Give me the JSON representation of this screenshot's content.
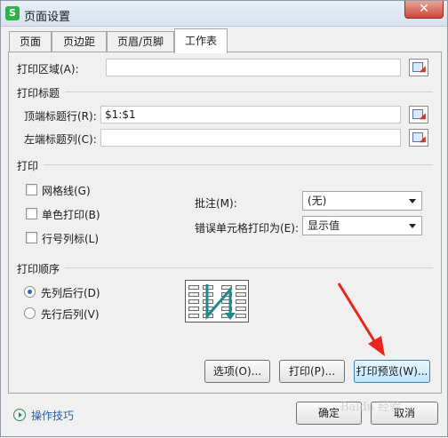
{
  "window": {
    "title": "页面设置",
    "app_icon_letter": "S",
    "close_glyph": "✕"
  },
  "tabs": [
    {
      "label": "页面"
    },
    {
      "label": "页边距"
    },
    {
      "label": "页眉/页脚"
    },
    {
      "label": "工作表",
      "active": true
    }
  ],
  "print_area": {
    "label": "打印区域(A):",
    "value": ""
  },
  "print_titles": {
    "section_label": "打印标题",
    "top_rows": {
      "label": "顶端标题行(R):",
      "value": "$1:$1"
    },
    "left_cols": {
      "label": "左端标题列(C):",
      "value": ""
    }
  },
  "print": {
    "section_label": "打印",
    "checkboxes": [
      {
        "label": "网格线(G)",
        "checked": false
      },
      {
        "label": "单色打印(B)",
        "checked": false
      },
      {
        "label": "行号列标(L)",
        "checked": false
      }
    ],
    "comments": {
      "label": "批注(M):",
      "value": "(无)"
    },
    "errors": {
      "label": "错误单元格打印为(E):",
      "value": "显示值"
    }
  },
  "page_order": {
    "section_label": "打印顺序",
    "options": [
      {
        "label": "先列后行(D)",
        "selected": true
      },
      {
        "label": "先行后列(V)",
        "selected": false
      }
    ]
  },
  "panel_buttons": {
    "options": "选项(O)...",
    "print": "打印(P)...",
    "preview": "打印预览(W)..."
  },
  "footer": {
    "tips": "操作技巧",
    "ok": "确定",
    "cancel": "取消",
    "watermark": "Baidu 经验"
  },
  "colors": {
    "accent": "#2a64b8",
    "annotation_arrow": "#e8261c"
  }
}
